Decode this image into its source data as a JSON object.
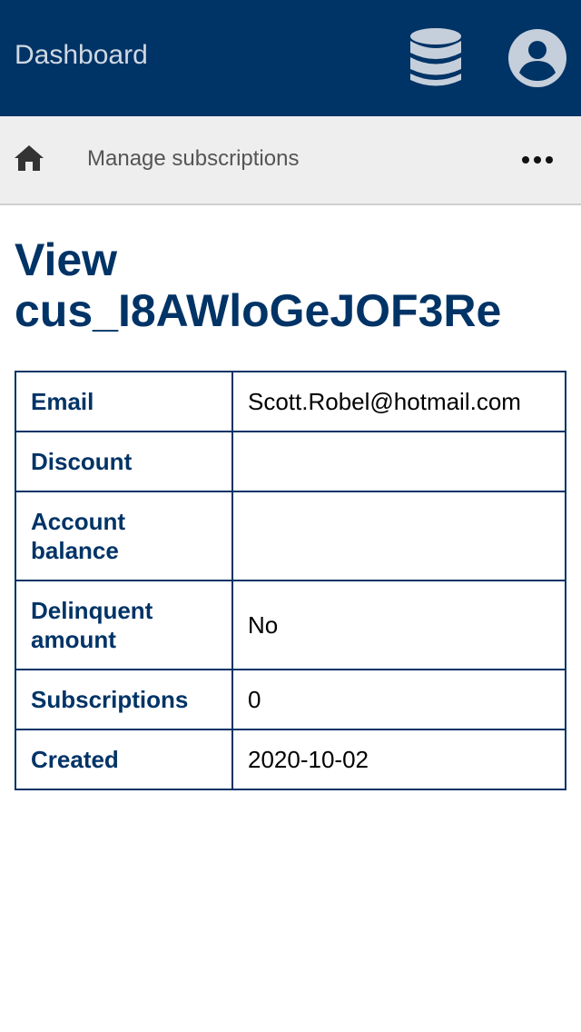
{
  "header": {
    "title": "Dashboard",
    "database_icon": "database-icon",
    "account_icon": "account-circle-icon"
  },
  "breadcrumb": {
    "home_icon": "home-icon",
    "label": "Manage subscriptions",
    "more_icon": "more-horizontal-icon"
  },
  "page": {
    "title": "View cus_I8AWloGeJOF3Re"
  },
  "details": {
    "rows": [
      {
        "label": "Email",
        "value": "Scott.Robel@hotmail.com"
      },
      {
        "label": "Discount",
        "value": ""
      },
      {
        "label": "Account balance",
        "value": ""
      },
      {
        "label": "Delinquent amount",
        "value": "No"
      },
      {
        "label": "Subscriptions",
        "value": "0"
      },
      {
        "label": "Created",
        "value": "2020-10-02"
      }
    ]
  },
  "colors": {
    "primary": "#003366",
    "subbar": "#eeeeee",
    "header_text": "#cfd8e3"
  }
}
